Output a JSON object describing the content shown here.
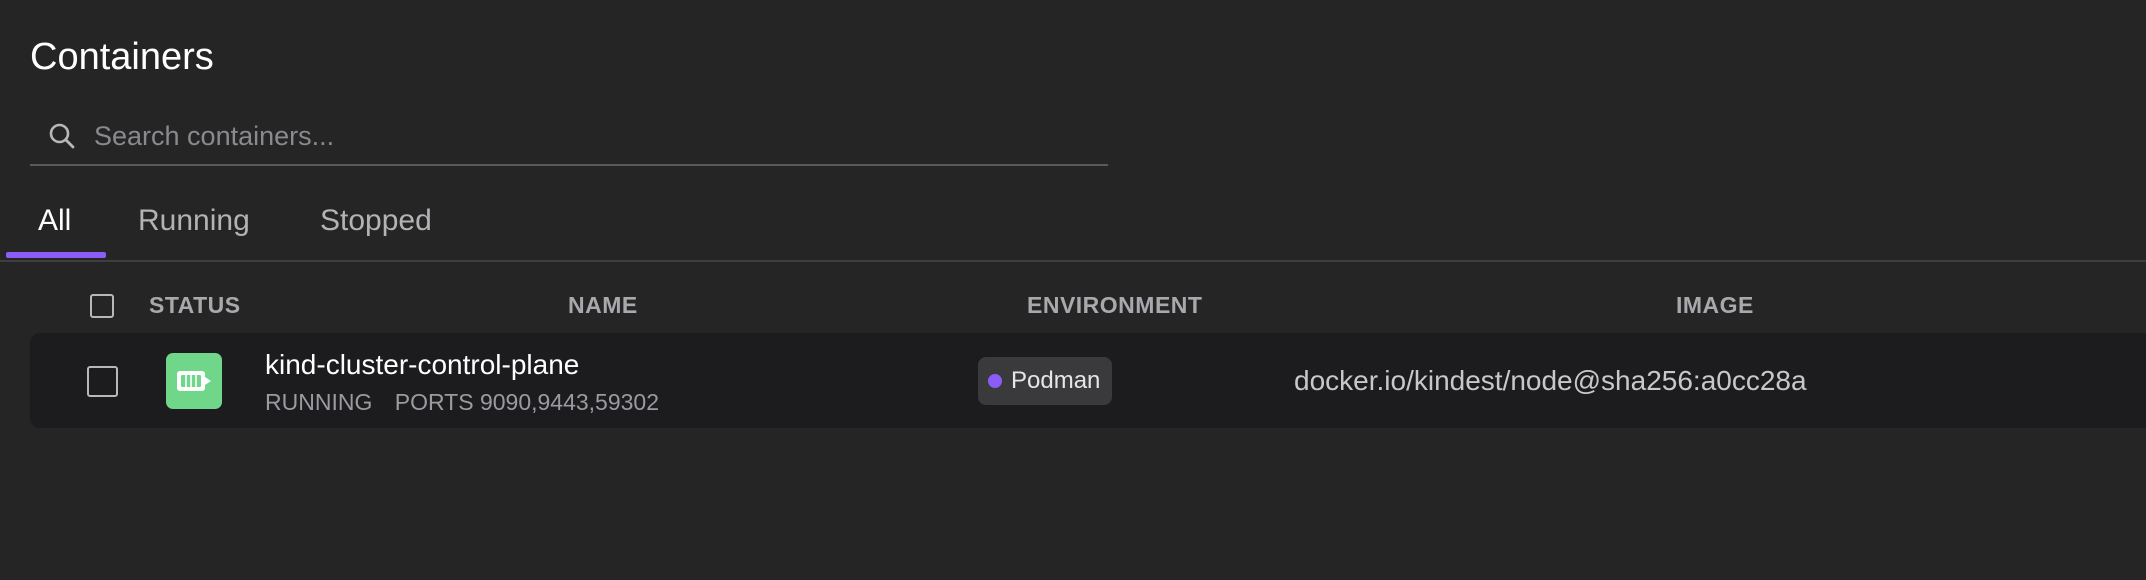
{
  "page": {
    "title": "Containers"
  },
  "search": {
    "placeholder": "Search containers..."
  },
  "tabs": [
    {
      "label": "All",
      "active": true
    },
    {
      "label": "Running",
      "active": false
    },
    {
      "label": "Stopped",
      "active": false
    }
  ],
  "table": {
    "columns": [
      "STATUS",
      "NAME",
      "ENVIRONMENT",
      "IMAGE"
    ],
    "rows": [
      {
        "name": "kind-cluster-control-plane",
        "state": "RUNNING",
        "ports": "PORTS 9090,9443,59302",
        "environment": "Podman",
        "image": "docker.io/kindest/node@sha256:a0cc28a",
        "status_icon": "container-icon"
      }
    ]
  },
  "colors": {
    "accent": "#8b5cf6",
    "running": "#6fd68a",
    "background": "#252526",
    "row_background": "#1c1c1e"
  }
}
